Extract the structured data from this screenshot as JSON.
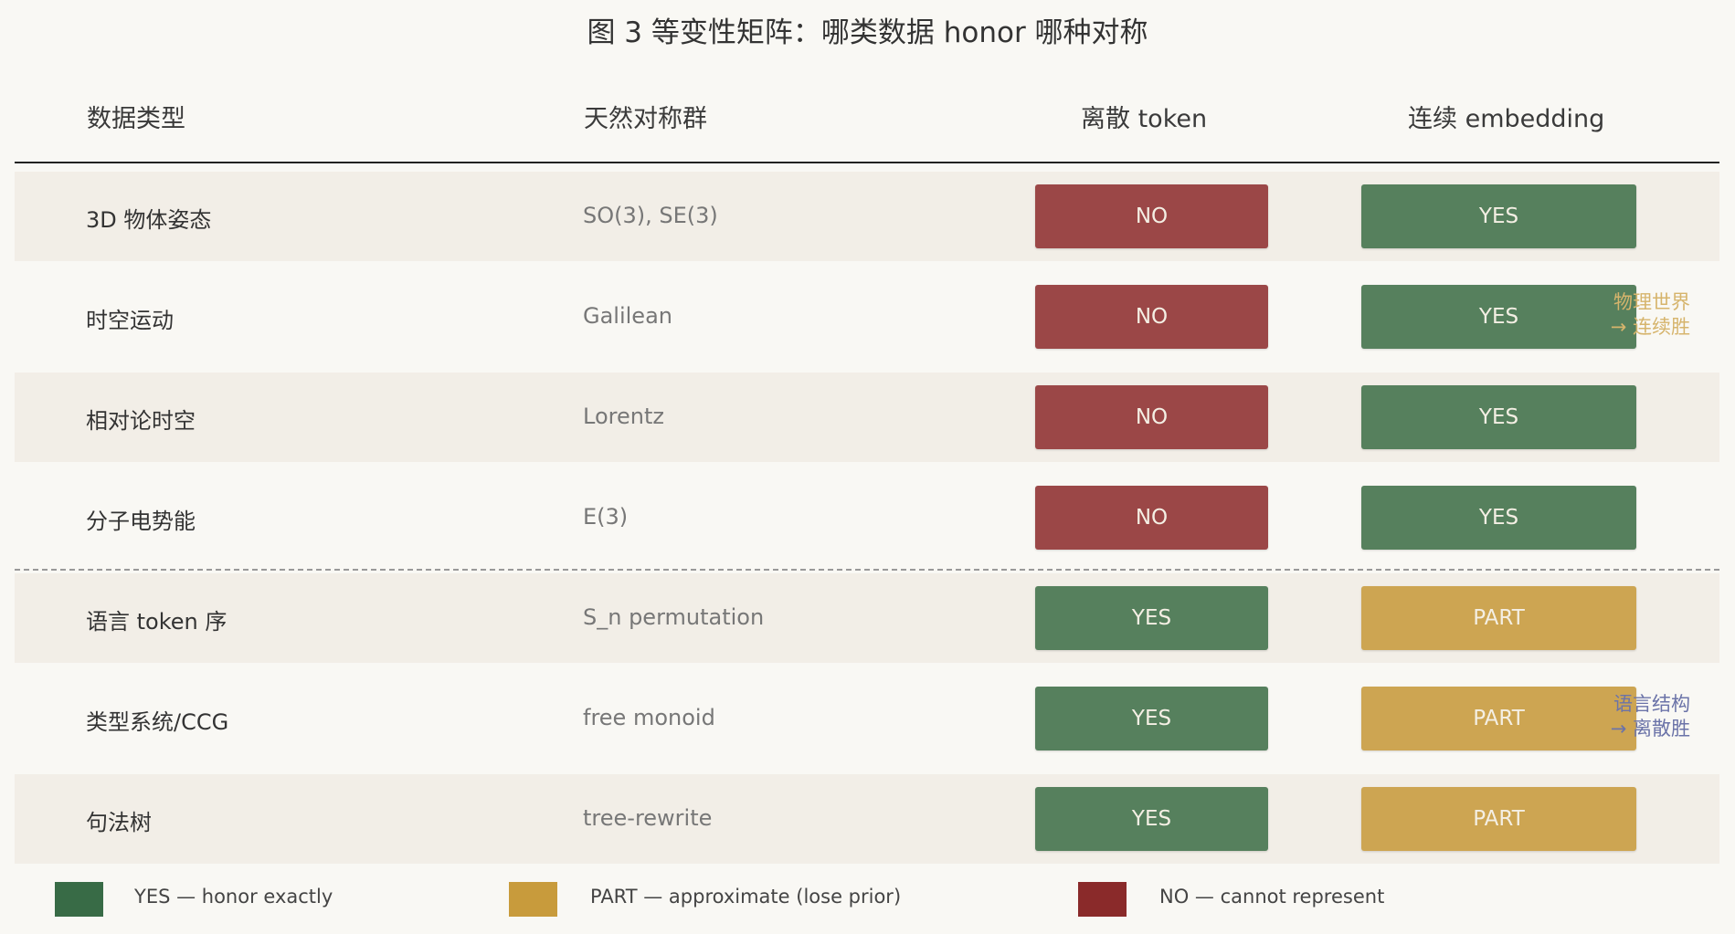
{
  "title": "图 3  等变性矩阵：哪类数据 honor 哪种对称",
  "headers": {
    "type": "数据类型",
    "group": "天然对称群",
    "token": "离散 token",
    "embedding": "连续 embedding"
  },
  "colors": {
    "yes": "#56805d",
    "no": "#9b4747",
    "part": "#cda552",
    "legend_yes": "#386b46",
    "legend_part": "#c89b3c",
    "legend_no": "#8a2a2a",
    "annot_physics": "#d6b46c",
    "annot_language": "#6b73a8"
  },
  "rows": [
    {
      "type": "3D 物体姿态",
      "group": "SO(3), SE(3)",
      "token": "NO",
      "embedding": "YES"
    },
    {
      "type": "时空运动",
      "group": "Galilean",
      "token": "NO",
      "embedding": "YES"
    },
    {
      "type": "相对论时空",
      "group": "Lorentz",
      "token": "NO",
      "embedding": "YES"
    },
    {
      "type": "分子电势能",
      "group": "E(3)",
      "token": "NO",
      "embedding": "YES"
    },
    {
      "type": "语言 token 序",
      "group": "S_n permutation",
      "token": "YES",
      "embedding": "PART"
    },
    {
      "type": "类型系统/CCG",
      "group": "free monoid",
      "token": "YES",
      "embedding": "PART"
    },
    {
      "type": "句法树",
      "group": "tree-rewrite",
      "token": "YES",
      "embedding": "PART"
    }
  ],
  "annotations": {
    "physics": {
      "line1": "物理世界",
      "line2": "→ 连续胜"
    },
    "language": {
      "line1": "语言结构",
      "line2": "→ 离散胜"
    }
  },
  "legend": {
    "yes": "YES — honor exactly",
    "part": "PART — approximate (lose prior)",
    "no": "NO — cannot represent"
  }
}
